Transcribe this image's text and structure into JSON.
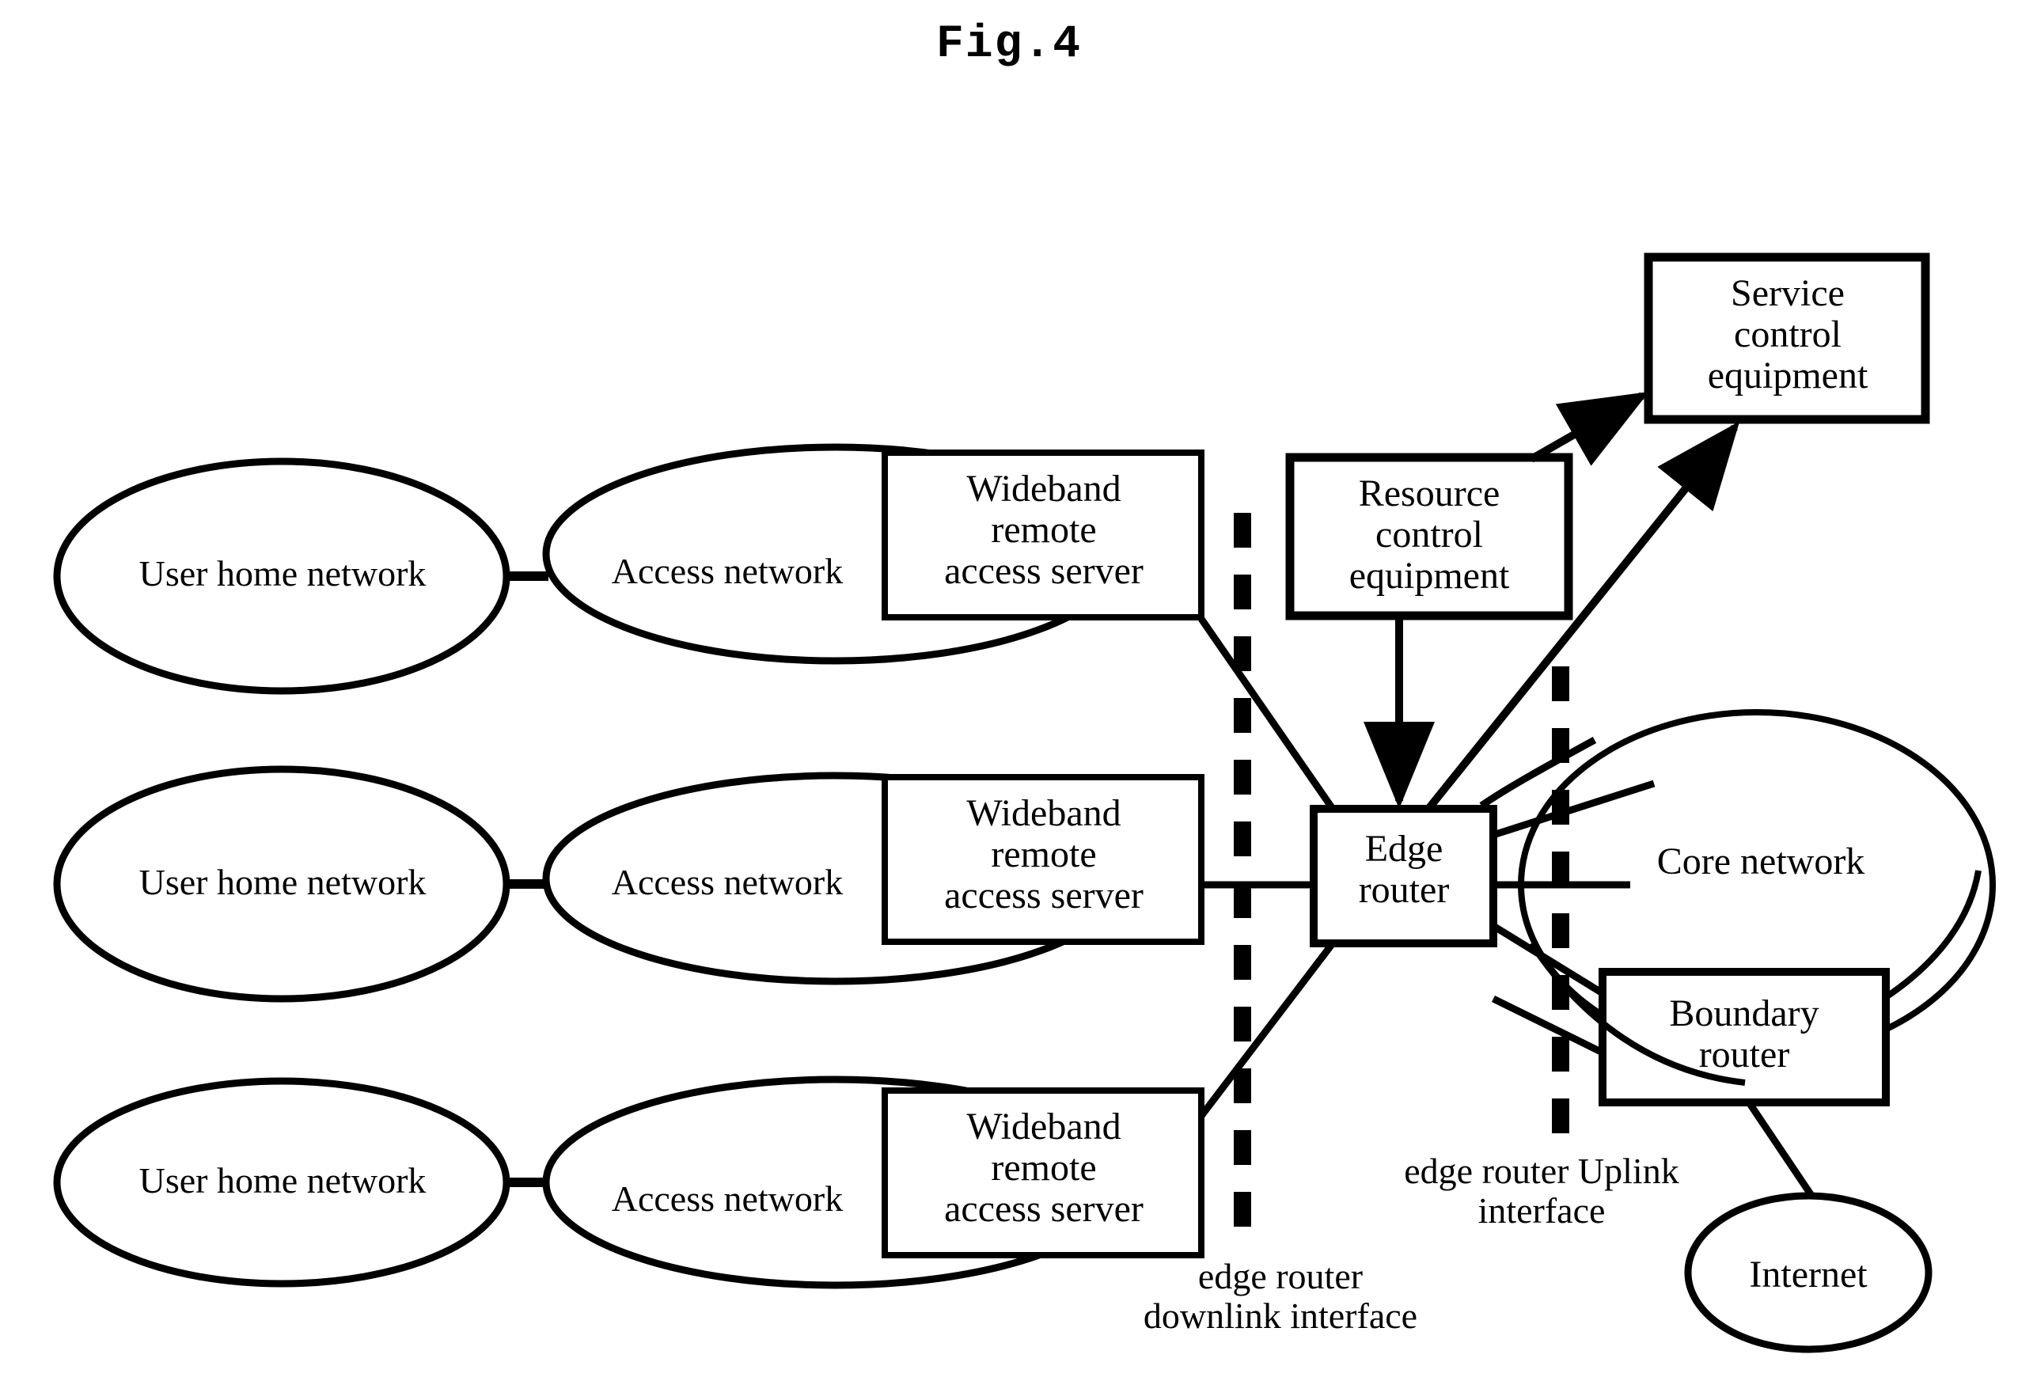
{
  "figure": {
    "title": "Fig.4",
    "type": "network-architecture-block-diagram",
    "line_color": "#000000",
    "background_color": "#ffffff"
  },
  "nodes": {
    "user_home_network_top": "User home network",
    "user_home_network_middle": "User home network",
    "user_home_network_bottom": "User home network",
    "access_network_top": "Access network",
    "access_network_middle": "Access network",
    "access_network_bottom": "Access network",
    "wideband_server_top": "Wideband\nremote\naccess server",
    "wideband_server_middle": "Wideband\nremote\naccess server",
    "wideband_server_bottom": "Wideband\nremote\naccess server",
    "service_control_equipment": "Service\ncontrol\nequipment",
    "resource_control_equipment": "Resource\ncontrol\nequipment",
    "edge_router": "Edge\nrouter",
    "core_network": "Core network",
    "boundary_router": "Boundary\nrouter",
    "internet": "Internet"
  },
  "interface_labels": {
    "downlink": "edge router\ndownlink interface",
    "uplink": "edge router Uplink\ninterface"
  }
}
